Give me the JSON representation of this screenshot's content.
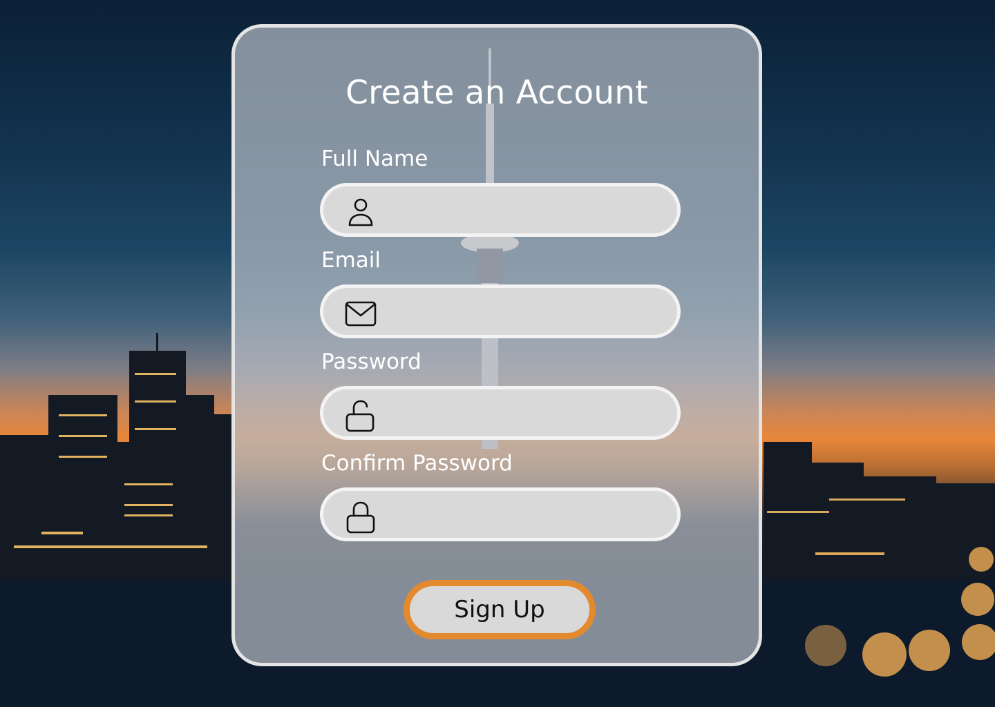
{
  "form": {
    "title": "Create an Account",
    "fields": [
      {
        "label": "Full Name",
        "icon": "user-icon",
        "value": "",
        "placeholder": ""
      },
      {
        "label": "Email",
        "icon": "mail-icon",
        "value": "",
        "placeholder": ""
      },
      {
        "label": "Password",
        "icon": "unlock-icon",
        "value": "",
        "placeholder": ""
      },
      {
        "label": "Confirm Password",
        "icon": "lock-icon",
        "value": "",
        "placeholder": ""
      }
    ],
    "submit_label": "Sign Up"
  },
  "colors": {
    "accent": "#e38a2e",
    "field_fill": "#d9d9d9",
    "card_border": "#e4e4e4",
    "text": "#ffffff"
  }
}
